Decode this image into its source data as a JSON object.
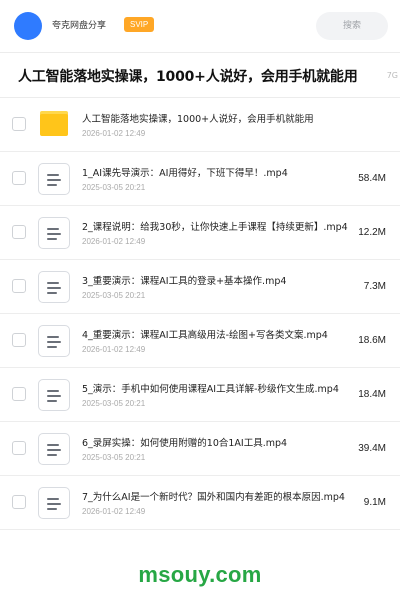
{
  "header": {
    "brand": "夸克网盘分享",
    "badge": "SVIP",
    "search_placeholder": "搜索"
  },
  "page_title": "人工智能落地实操课，1000+人说好，会用手机就能用",
  "total_size_partial": "7G",
  "files": [
    {
      "type": "folder",
      "name": "人工智能落地实操课，1000+人说好，会用手机就能用",
      "date": "2026-01-02 12:49",
      "size": ""
    },
    {
      "type": "file",
      "name": "1_AI课先导演示：AI用得好，下班下得早！.mp4",
      "date": "2025-03-05 20:21",
      "size": "58.4M"
    },
    {
      "type": "file",
      "name": "2_课程说明：给我30秒，让你快速上手课程【持续更新】.mp4",
      "date": "2026-01-02 12:49",
      "size": "12.2M"
    },
    {
      "type": "file",
      "name": "3_重要演示：课程AI工具的登录+基本操作.mp4",
      "date": "2025-03-05 20:21",
      "size": "7.3M"
    },
    {
      "type": "file",
      "name": "4_重要演示：课程AI工具高级用法-绘图+写各类文案.mp4",
      "date": "2026-01-02 12:49",
      "size": "18.6M"
    },
    {
      "type": "file",
      "name": "5_演示：手机中如何使用课程AI工具详解-秒级作文生成.mp4",
      "date": "2025-03-05 20:21",
      "size": "18.4M"
    },
    {
      "type": "file",
      "name": "6_录屏实操：如何使用附赠的10合1AI工具.mp4",
      "date": "2025-03-05 20:21",
      "size": "39.4M"
    },
    {
      "type": "file",
      "name": "7_为什么AI是一个新时代？国外和国内有差距的根本原因.mp4",
      "date": "2026-01-02 12:49",
      "size": "9.1M"
    }
  ],
  "watermark": "msouy.com",
  "colors": {
    "avatar": "#2f7bff",
    "badge": "#ffa726",
    "folder": "#ffc51a",
    "watermark": "#27a745"
  }
}
